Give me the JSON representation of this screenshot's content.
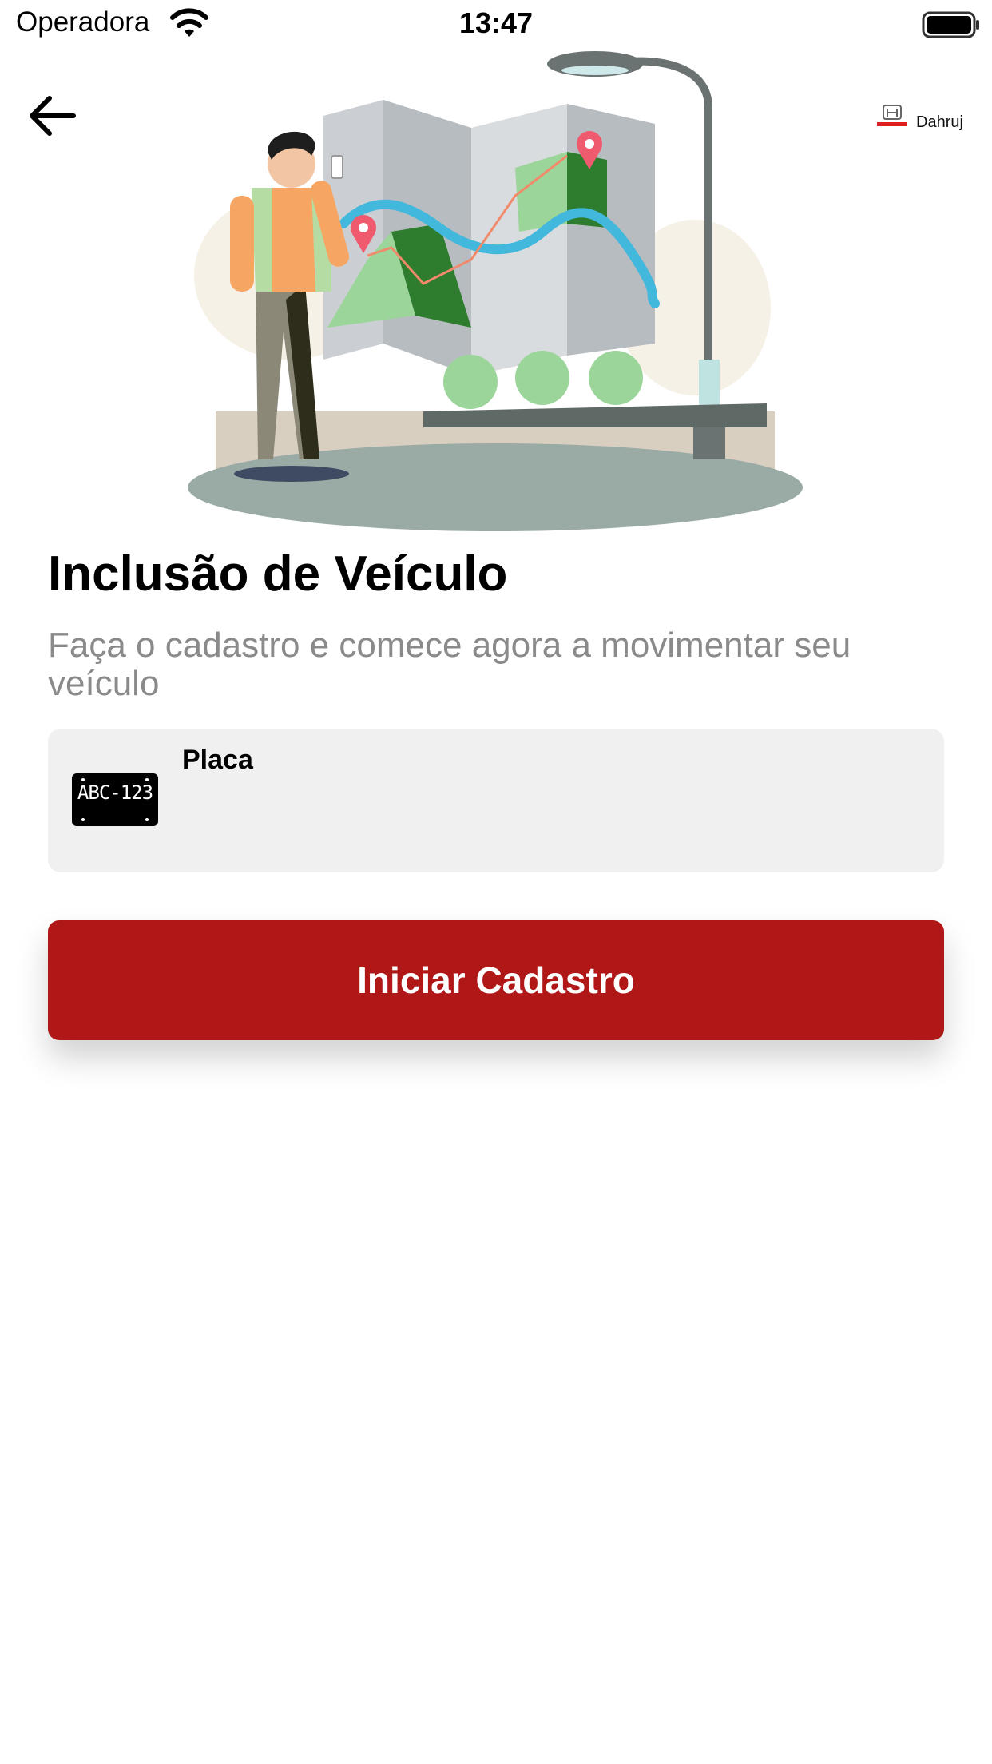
{
  "status_bar": {
    "carrier": "Operadora",
    "time": "13:47"
  },
  "header": {
    "back_icon": "arrow-left-icon",
    "brand_logo": "honda-logo",
    "brand_name": "Dahruj"
  },
  "illustration": {
    "name": "person-with-map-illustration"
  },
  "main": {
    "title": "Inclusão de Veículo",
    "subtitle": "Faça o cadastro e comece agora a movimentar seu veículo",
    "plate_field": {
      "label": "Placa",
      "icon_text": "ABC-123",
      "value": "",
      "placeholder": ""
    },
    "submit_button_label": "Iniciar Cadastro"
  },
  "colors": {
    "accent": "#b01817",
    "subtitle": "#8a8a8a",
    "field_background": "#f0f0f0"
  }
}
